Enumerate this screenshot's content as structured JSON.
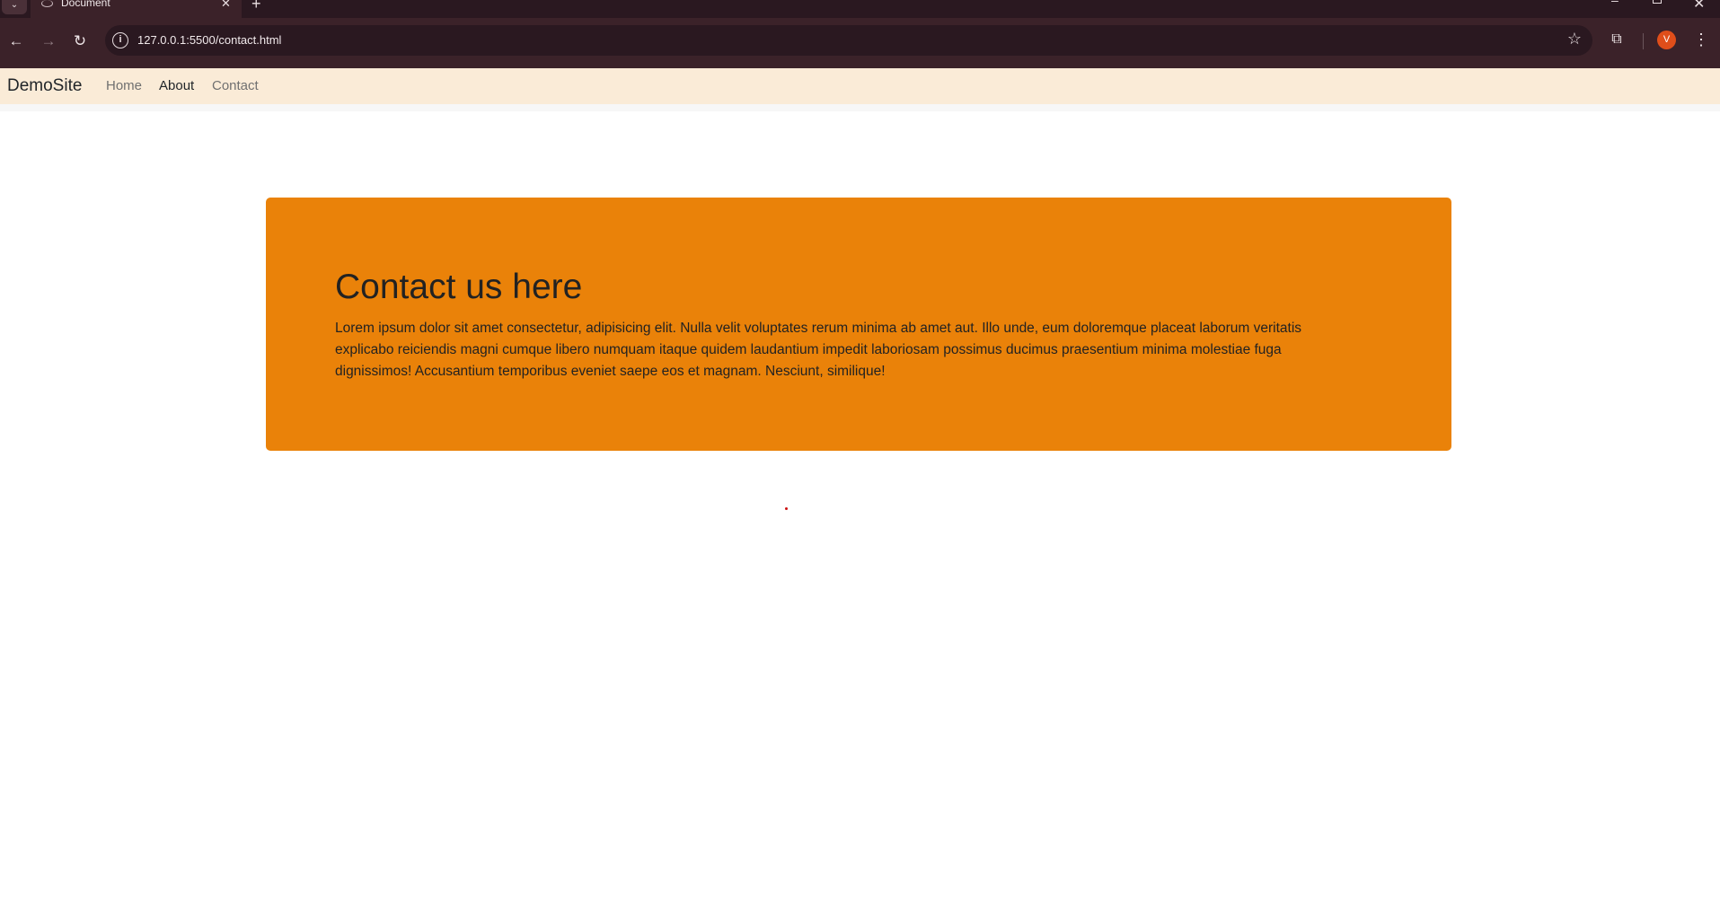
{
  "browser": {
    "tab_title": "Document",
    "url": "127.0.0.1:5500/contact.html",
    "profile_initial": "V"
  },
  "navbar": {
    "brand": "DemoSite",
    "links": [
      "Home",
      "About",
      "Contact"
    ]
  },
  "hero": {
    "title": "Contact us here",
    "body": "Lorem ipsum dolor sit amet consectetur, adipisicing elit. Nulla velit voluptates rerum minima ab amet aut. Illo unde, eum doloremque placeat laborum veritatis explicabo reiciendis magni cumque libero numquam itaque quidem laudantium impedit laboriosam possimus ducimus praesentium minima molestiae fuga dignissimos! Accusantium temporibus eveniet saepe eos et magnam. Nesciunt, similique!"
  },
  "colors": {
    "hero_background": "#ea8209",
    "navbar_background": "#faebd7",
    "browser_frame": "#3b2229"
  },
  "icons": [
    "tab-list-icon",
    "globe-icon",
    "close-icon",
    "plus-icon",
    "minimize-icon",
    "maximize-icon",
    "window-close-icon",
    "back-arrow-icon",
    "forward-arrow-icon",
    "reload-icon",
    "site-info-icon",
    "bookmark-star-icon",
    "extensions-icon",
    "kebab-menu-icon"
  ]
}
